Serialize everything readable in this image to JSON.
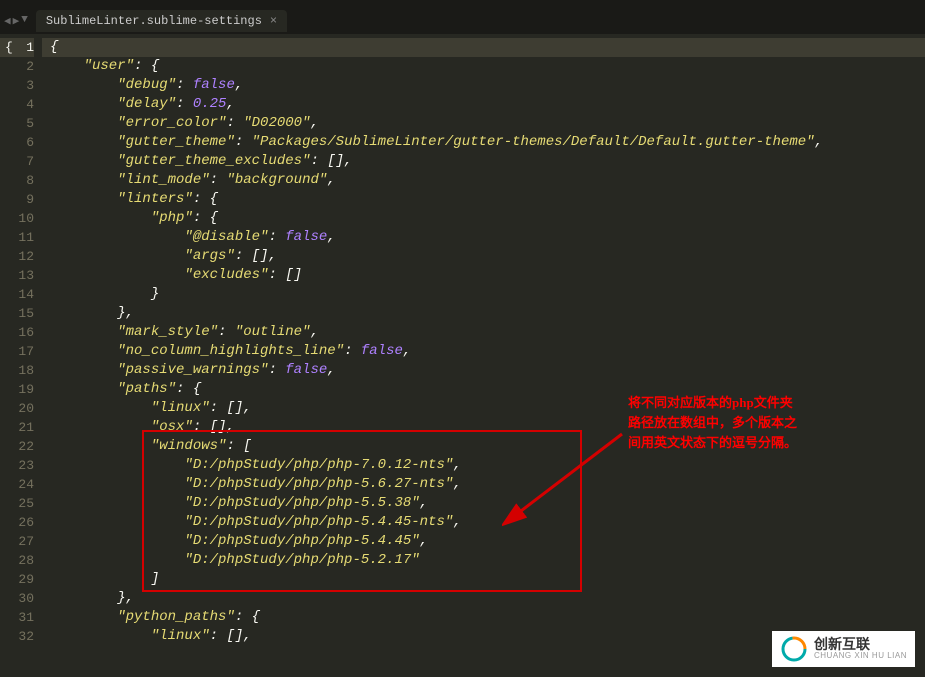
{
  "tab": {
    "title": "SublimeLinter.sublime-settings",
    "close": "×"
  },
  "nav": {
    "back": "◀",
    "forward": "▶",
    "down": "▼"
  },
  "lines": {
    "l1": "{",
    "l2a": "    \"user\"",
    "l2b": ": {",
    "l3a": "        \"debug\"",
    "l3b": ": ",
    "l3c": "false",
    "l3d": ",",
    "l4a": "        \"delay\"",
    "l4b": ": ",
    "l4c": "0.25",
    "l4d": ",",
    "l5a": "        \"error_color\"",
    "l5b": ": ",
    "l5c": "\"D02000\"",
    "l5d": ",",
    "l6a": "        \"gutter_theme\"",
    "l6b": ": ",
    "l6c": "\"Packages/SublimeLinter/gutter-themes/Default/Default.gutter-theme\"",
    "l6d": ",",
    "l7a": "        \"gutter_theme_excludes\"",
    "l7b": ": [],",
    "l8a": "        \"lint_mode\"",
    "l8b": ": ",
    "l8c": "\"background\"",
    "l8d": ",",
    "l9a": "        \"linters\"",
    "l9b": ": {",
    "l10a": "            \"php\"",
    "l10b": ": {",
    "l11a": "                \"@disable\"",
    "l11b": ": ",
    "l11c": "false",
    "l11d": ",",
    "l12a": "                \"args\"",
    "l12b": ": [],",
    "l13a": "                \"excludes\"",
    "l13b": ": []",
    "l14": "            }",
    "l15": "        },",
    "l16a": "        \"mark_style\"",
    "l16b": ": ",
    "l16c": "\"outline\"",
    "l16d": ",",
    "l17a": "        \"no_column_highlights_line\"",
    "l17b": ": ",
    "l17c": "false",
    "l17d": ",",
    "l18a": "        \"passive_warnings\"",
    "l18b": ": ",
    "l18c": "false",
    "l18d": ",",
    "l19a": "        \"paths\"",
    "l19b": ": {",
    "l20a": "            \"linux\"",
    "l20b": ": [],",
    "l21a": "            \"osx\"",
    "l21b": ": [],",
    "l22a": "            \"windows\"",
    "l22b": ": [",
    "l23a": "                \"D:/phpStudy/php/php-7.0.12-nts\"",
    "l23b": ",",
    "l24a": "                \"D:/phpStudy/php/php-5.6.27-nts\"",
    "l24b": ",",
    "l25a": "                \"D:/phpStudy/php/php-5.5.38\"",
    "l25b": ",",
    "l26a": "                \"D:/phpStudy/php/php-5.4.45-nts\"",
    "l26b": ",",
    "l27a": "                \"D:/phpStudy/php/php-5.4.45\"",
    "l27b": ",",
    "l28a": "                \"D:/phpStudy/php/php-5.2.17\"",
    "l29": "            ]",
    "l30": "        },",
    "l31a": "        \"python_paths\"",
    "l31b": ": {",
    "l32a": "            \"linux\"",
    "l32b": ": [],"
  },
  "lineNumbers": [
    "1",
    "2",
    "3",
    "4",
    "5",
    "6",
    "7",
    "8",
    "9",
    "10",
    "11",
    "12",
    "13",
    "14",
    "15",
    "16",
    "17",
    "18",
    "19",
    "20",
    "21",
    "22",
    "23",
    "24",
    "25",
    "26",
    "27",
    "28",
    "29",
    "30",
    "31",
    "32"
  ],
  "annotation": {
    "line1": "将不同对应版本的php文件夹",
    "line2": "路径放在数组中，多个版本之",
    "line3": "间用英文状态下的逗号分隔。"
  },
  "logo": {
    "cn": "创新互联",
    "en": "CHUANG XIN HU LIAN"
  },
  "brace": "{"
}
